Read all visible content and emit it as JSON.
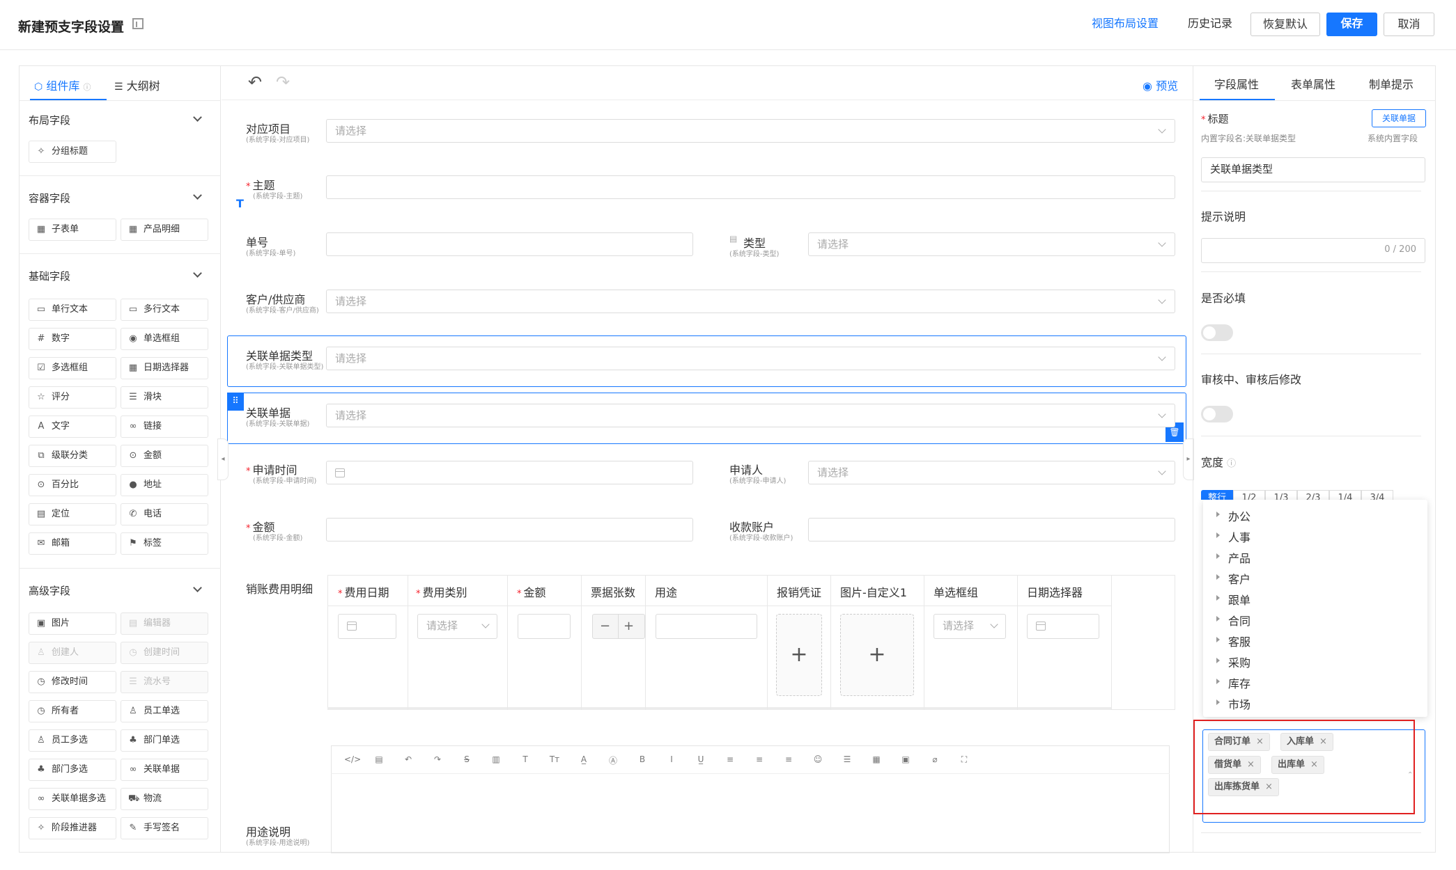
{
  "header": {
    "title": "新建预支字段设置",
    "view_layout": "视图布局设置",
    "history": "历史记录",
    "restore": "恢复默认",
    "save": "保存",
    "cancel": "取消"
  },
  "left": {
    "tab_library": "组件库",
    "tab_outline": "大纲树",
    "groups": [
      {
        "title": "布局字段",
        "items": [
          "分组标题"
        ]
      },
      {
        "title": "容器字段",
        "items": [
          "子表单",
          "产品明细"
        ]
      },
      {
        "title": "基础字段",
        "items": [
          "单行文本",
          "多行文本",
          "数字",
          "单选框组",
          "多选框组",
          "日期选择器",
          "评分",
          "滑块",
          "文字",
          "链接",
          "级联分类",
          "金额",
          "百分比",
          "地址",
          "定位",
          "电话",
          "邮箱",
          "标签"
        ]
      },
      {
        "title": "高级字段",
        "items": [
          "图片",
          "编辑器",
          "创建人",
          "创建时间",
          "修改时间",
          "流水号",
          "所有者",
          "员工单选",
          "员工多选",
          "部门单选",
          "部门多选",
          "关联单据",
          "关联单据多选",
          "物流",
          "阶段推进器",
          "手写签名"
        ]
      }
    ]
  },
  "toolbar": {
    "preview": "预览"
  },
  "form": {
    "placeholder_select": "请选择",
    "fields": {
      "project": {
        "label": "对应项目",
        "sub": "(系统字段-对应项目)"
      },
      "subject": {
        "label": "主题",
        "sub": "(系统字段-主题)"
      },
      "number": {
        "label": "单号",
        "sub": "(系统字段-单号)"
      },
      "type": {
        "label": "类型",
        "sub": "(系统字段-类型)"
      },
      "customer": {
        "label": "客户/供应商",
        "sub": "(系统字段-客户/供应商)"
      },
      "rel_type": {
        "label": "关联单据类型",
        "sub": "(系统字段-关联单据类型)"
      },
      "rel_doc": {
        "label": "关联单据",
        "sub": "(系统字段-关联单据)"
      },
      "apply_time": {
        "label": "申请时间",
        "sub": "(系统字段-申请时间)"
      },
      "applicant": {
        "label": "申请人",
        "sub": "(系统字段-申请人)"
      },
      "amount": {
        "label": "金额",
        "sub": "(系统字段-金额)"
      },
      "account": {
        "label": "收款账户",
        "sub": "(系统字段-收款账户)"
      },
      "detail": {
        "label": "销账费用明细"
      },
      "purpose": {
        "label": "用途说明",
        "sub": "(系统字段-用途说明)"
      }
    },
    "table_headers": [
      "费用日期",
      "费用类别",
      "金额",
      "票据张数",
      "用途",
      "报销凭证",
      "图片-自定义1",
      "单选框组",
      "日期选择器"
    ]
  },
  "right": {
    "tabs": [
      "字段属性",
      "表单属性",
      "制单提示"
    ],
    "title_label": "标题",
    "badge": "关联单据",
    "builtin_name": "内置字段名:关联单据类型",
    "builtin": "系统内置字段",
    "title_value": "关联单据类型",
    "hint_label": "提示说明",
    "counter": "0 / 200",
    "required_label": "是否必填",
    "modify_label": "审核中、审核后修改",
    "width_label": "宽度",
    "width_options": [
      "整行",
      "1/2",
      "1/3",
      "2/3",
      "1/4",
      "3/4"
    ],
    "tree": [
      "办公",
      "人事",
      "产品",
      "客户",
      "跟单",
      "合同",
      "客服",
      "采购",
      "库存",
      "市场"
    ],
    "tags": [
      "合同订单",
      "入库单",
      "借货单",
      "出库单",
      "出库拣货单"
    ]
  },
  "colors": {
    "primary": "#1677ff",
    "highlight": "#e02020"
  }
}
